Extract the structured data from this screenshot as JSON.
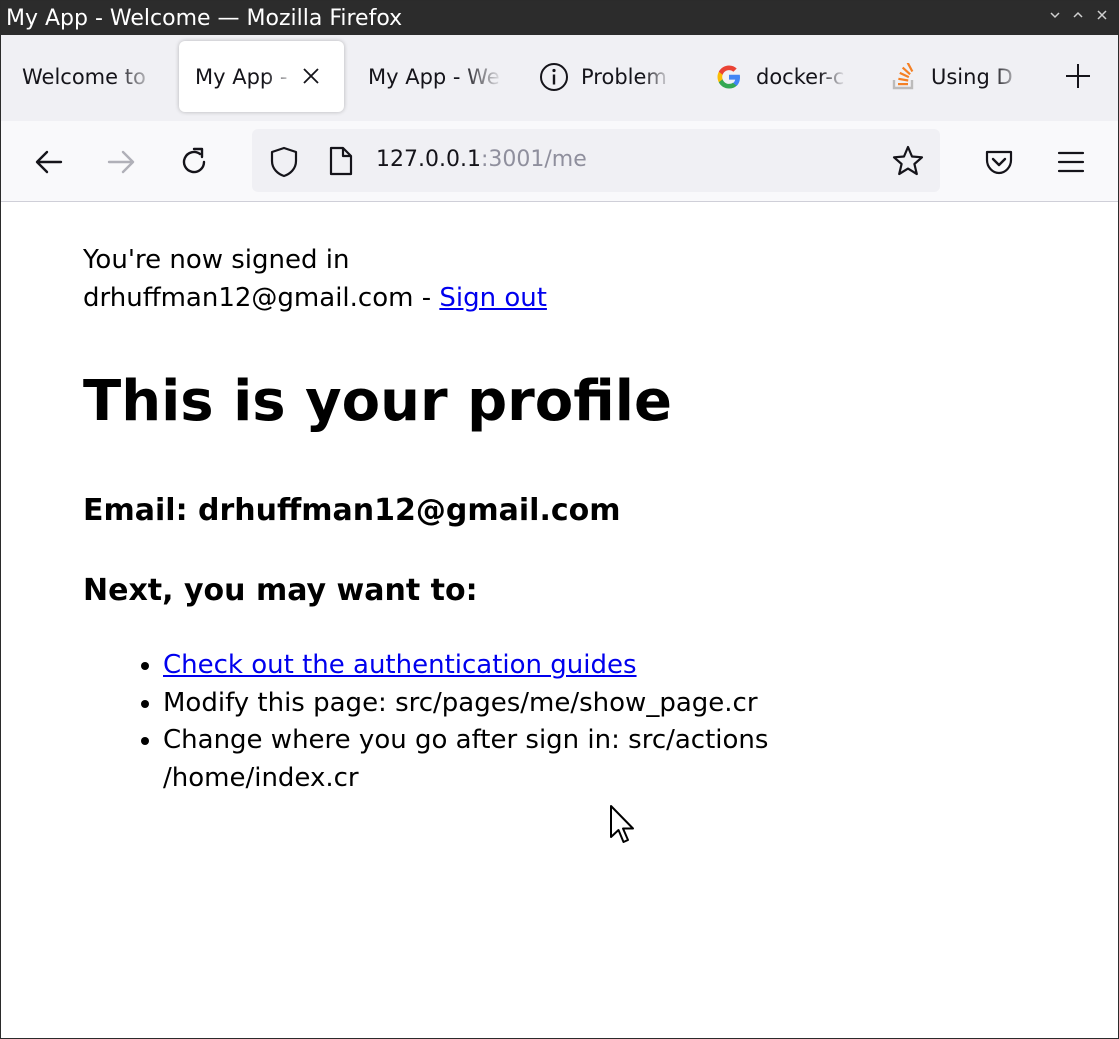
{
  "window": {
    "title": "My App - Welcome — Mozilla Firefox"
  },
  "tabs": [
    {
      "label": "Welcome to",
      "icon": "none",
      "active": false
    },
    {
      "label": "My App - ",
      "icon": "none",
      "active": true
    },
    {
      "label": "My App - We",
      "icon": "none",
      "active": false
    },
    {
      "label": "Problem",
      "icon": "info-icon",
      "active": false
    },
    {
      "label": "docker-c",
      "icon": "google-icon",
      "active": false
    },
    {
      "label": "Using D",
      "icon": "stackoverflow-icon",
      "active": false
    }
  ],
  "urlbar": {
    "host": "127.0.0.1",
    "rest": ":3001/me"
  },
  "page": {
    "signed_in_text": "You're now signed in",
    "user_email": "drhuffman12@gmail.com",
    "separator": " - ",
    "sign_out": "Sign out",
    "heading": "This is your profile",
    "email_heading": "Email: drhuffman12@gmail.com",
    "next_heading": "Next, you may want to:",
    "next_items": [
      "Check out the authentication guides",
      "Modify this page: src/pages/me/show_page.cr",
      "Change where you go after sign in: src/actions /home/index.cr"
    ]
  },
  "colors": {
    "link": "#0000ee",
    "titlebar": "#2c2c2c",
    "tabstrip": "#f0f0f4",
    "navbar": "#f9f9fb"
  }
}
